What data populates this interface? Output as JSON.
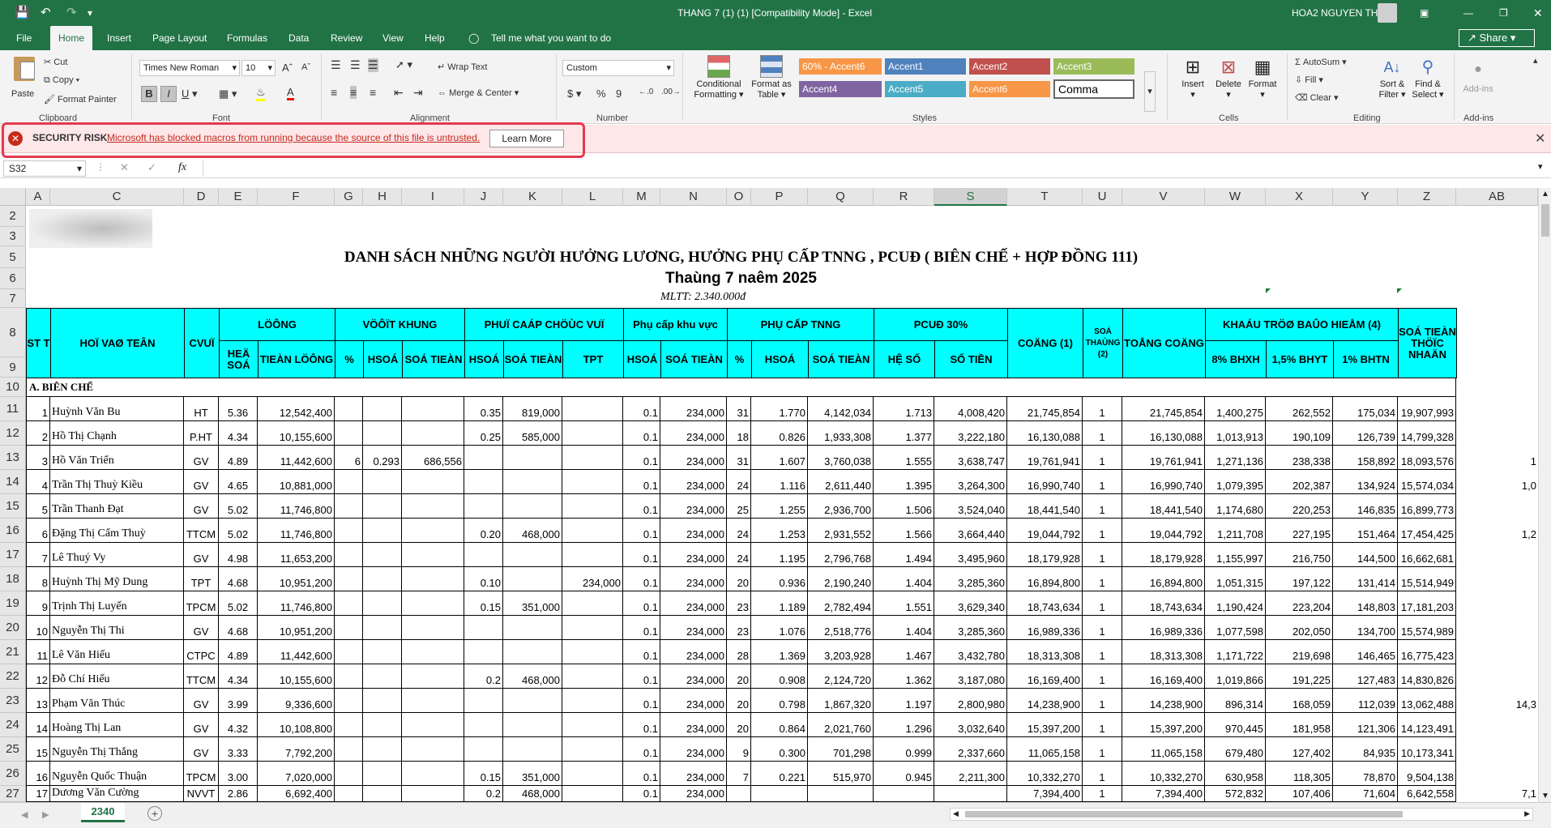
{
  "titlebar": {
    "doc_title": "THANG 7 (1) (1)  [Compatibility Mode]  -  Excel",
    "user": "HOA2 NGUYEN THI"
  },
  "tabs": [
    "File",
    "Home",
    "Insert",
    "Page Layout",
    "Formulas",
    "Data",
    "Review",
    "View",
    "Help"
  ],
  "tell_me": "Tell me what you want to do",
  "share": "Share",
  "ribbon": {
    "paste": "Paste",
    "cut": "Cut",
    "copy": "Copy",
    "format_painter": "Format Painter",
    "clipboard": "Clipboard",
    "font_name": "Times New Roman",
    "font_size": "10",
    "font_group": "Font",
    "bold": "B",
    "italic": "I",
    "underline": "U",
    "wrap_text": "Wrap Text",
    "merge_center": "Merge & Center",
    "alignment": "Alignment",
    "number_format": "Custom",
    "number": "Number",
    "cond_fmt_1": "Conditional",
    "cond_fmt_2": "Formatting",
    "fmt_table_1": "Format as",
    "fmt_table_2": "Table",
    "styles_group": "Styles",
    "styles": [
      {
        "label": "60% - Accent6",
        "color": "#f79646"
      },
      {
        "label": "Accent1",
        "color": "#4f81bd"
      },
      {
        "label": "Accent2",
        "color": "#c0504d"
      },
      {
        "label": "Accent3",
        "color": "#9bbb59"
      },
      {
        "label": "Accent4",
        "color": "#8064a2"
      },
      {
        "label": "Accent5",
        "color": "#4bacc6"
      },
      {
        "label": "Accent6",
        "color": "#f79646"
      },
      {
        "label": "Comma",
        "color": "#ffffff"
      }
    ],
    "insert": "Insert",
    "delete": "Delete",
    "format": "Format",
    "cells": "Cells",
    "autosum": "AutoSum",
    "fill": "Fill",
    "clear": "Clear",
    "sort_1": "Sort &",
    "sort_2": "Filter",
    "find_1": "Find &",
    "find_2": "Select",
    "editing": "Editing",
    "addins": "Add-ins",
    "addins_group": "Add-ins"
  },
  "security": {
    "label": "SECURITY RISK",
    "message": "Microsoft has blocked macros from running because the source of this file is untrusted.",
    "button": "Learn More"
  },
  "formula_bar": {
    "name_box": "S32",
    "fx": "fx",
    "value": ""
  },
  "columns": [
    "A",
    "C",
    "D",
    "E",
    "F",
    "G",
    "H",
    "I",
    "J",
    "K",
    "L",
    "M",
    "N",
    "O",
    "P",
    "Q",
    "R",
    "S",
    "T",
    "U",
    "V",
    "W",
    "X",
    "Y",
    "Z",
    "AB"
  ],
  "row_numbers": [
    "2",
    "3",
    "5",
    "6",
    "7",
    "8",
    "9",
    "10",
    "11",
    "12",
    "13",
    "14",
    "15",
    "16",
    "17",
    "18",
    "19",
    "20",
    "21",
    "22",
    "23",
    "24",
    "25",
    "26",
    "27"
  ],
  "sheet": {
    "title": "DANH SÁCH NHỮNG NGƯỜI HƯỞNG LƯƠNG, HƯỞNG PHỤ CẤP TNNG , PCUĐ ( BIÊN CHẾ + HỢP ĐỒNG 111)",
    "subtitle": "Thaùng 7 naêm 2025",
    "mltt": "MLTT: 2.340.000đ",
    "section_a": "A. BIÊN CHẾ"
  },
  "headers": {
    "stt": "ST T",
    "hoten": "HOÏ VAØ TEÂN",
    "cvu": "CVUÏ",
    "luong": "LÖÔNG",
    "heso": "HEÄ SOÁ",
    "tienluong": "TIEÀN LÖÔNG",
    "vuotkhung": "VÖÔÏT KHUNG",
    "pct": "%",
    "hsoa": "HSOÁ",
    "sotien": "SOÁ TIEÀN",
    "pccv": "PHUÏ CAÁP CHÖÙC VUÏ",
    "tpt": "TPT",
    "kv": "Phụ cấp khu vực",
    "tnng": "PHỤ CẤP TNNG",
    "pcud": "PCUĐ 30%",
    "heso2": "HỆ SỐ",
    "sotien2": "SỐ TIỀN",
    "cong1": "COÄNG (1)",
    "sothang": "SOÁ THAÙNG (2)",
    "tongcong": "TOÅNG COÄNG",
    "khautru": "KHAÁU TRÖØ BAÛO HIEÅM (4)",
    "bhxh": "8% BHXH",
    "bhyt": "1,5% BHYT",
    "bhtn": "1%   BHTN",
    "thucnhan": "SOÁ TIEÀN THÖÏC NHAÄN"
  },
  "rows": [
    [
      "1",
      "Huỳnh Văn Bu",
      "HT",
      "5.36",
      "12,542,400",
      "",
      "",
      "",
      "0.35",
      "819,000",
      "",
      "0.1",
      "234,000",
      "31",
      "1.770",
      "4,142,034",
      "1.713",
      "4,008,420",
      "21,745,854",
      "1",
      "21,745,854",
      "1,400,275",
      "262,552",
      "175,034",
      "19,907,993",
      ""
    ],
    [
      "2",
      "Hồ Thị Chạnh",
      "P.HT",
      "4.34",
      "10,155,600",
      "",
      "",
      "",
      "0.25",
      "585,000",
      "",
      "0.1",
      "234,000",
      "18",
      "0.826",
      "1,933,308",
      "1.377",
      "3,222,180",
      "16,130,088",
      "1",
      "16,130,088",
      "1,013,913",
      "190,109",
      "126,739",
      "14,799,328",
      ""
    ],
    [
      "3",
      "Hồ Văn Triển",
      "GV",
      "4.89",
      "11,442,600",
      "6",
      "0.293",
      "686,556",
      "",
      "",
      "",
      "0.1",
      "234,000",
      "31",
      "1.607",
      "3,760,038",
      "1.555",
      "3,638,747",
      "19,761,941",
      "1",
      "19,761,941",
      "1,271,136",
      "238,338",
      "158,892",
      "18,093,576",
      "1"
    ],
    [
      "4",
      "Trần Thị Thuỳ Kiều",
      "GV",
      "4.65",
      "10,881,000",
      "",
      "",
      "",
      "",
      "",
      "",
      "0.1",
      "234,000",
      "24",
      "1.116",
      "2,611,440",
      "1.395",
      "3,264,300",
      "16,990,740",
      "1",
      "16,990,740",
      "1,079,395",
      "202,387",
      "134,924",
      "15,574,034",
      "1,0"
    ],
    [
      "5",
      "Trần Thanh Đạt",
      "GV",
      "5.02",
      "11,746,800",
      "",
      "",
      "",
      "",
      "",
      "",
      "0.1",
      "234,000",
      "25",
      "1.255",
      "2,936,700",
      "1.506",
      "3,524,040",
      "18,441,540",
      "1",
      "18,441,540",
      "1,174,680",
      "220,253",
      "146,835",
      "16,899,773",
      ""
    ],
    [
      "6",
      "Đặng Thị Cẩm Thuỳ",
      "TTCM",
      "5.02",
      "11,746,800",
      "",
      "",
      "",
      "0.20",
      "468,000",
      "",
      "0.1",
      "234,000",
      "24",
      "1.253",
      "2,931,552",
      "1.566",
      "3,664,440",
      "19,044,792",
      "1",
      "19,044,792",
      "1,211,708",
      "227,195",
      "151,464",
      "17,454,425",
      "1,2"
    ],
    [
      "7",
      "Lê Thuý Vy",
      "GV",
      "4.98",
      "11,653,200",
      "",
      "",
      "",
      "",
      "",
      "",
      "0.1",
      "234,000",
      "24",
      "1.195",
      "2,796,768",
      "1.494",
      "3,495,960",
      "18,179,928",
      "1",
      "18,179,928",
      "1,155,997",
      "216,750",
      "144,500",
      "16,662,681",
      ""
    ],
    [
      "8",
      "Huỳnh Thị Mỹ Dung",
      "TPT",
      "4.68",
      "10,951,200",
      "",
      "",
      "",
      "0.10",
      "",
      "234,000",
      "0.1",
      "234,000",
      "20",
      "0.936",
      "2,190,240",
      "1.404",
      "3,285,360",
      "16,894,800",
      "1",
      "16,894,800",
      "1,051,315",
      "197,122",
      "131,414",
      "15,514,949",
      ""
    ],
    [
      "9",
      "Trịnh Thị Luyến",
      "TPCM",
      "5.02",
      "11,746,800",
      "",
      "",
      "",
      "0.15",
      "351,000",
      "",
      "0.1",
      "234,000",
      "23",
      "1.189",
      "2,782,494",
      "1.551",
      "3,629,340",
      "18,743,634",
      "1",
      "18,743,634",
      "1,190,424",
      "223,204",
      "148,803",
      "17,181,203",
      ""
    ],
    [
      "10",
      "Nguyễn Thị Thi",
      "GV",
      "4.68",
      "10,951,200",
      "",
      "",
      "",
      "",
      "",
      "",
      "0.1",
      "234,000",
      "23",
      "1.076",
      "2,518,776",
      "1.404",
      "3,285,360",
      "16,989,336",
      "1",
      "16,989,336",
      "1,077,598",
      "202,050",
      "134,700",
      "15,574,989",
      ""
    ],
    [
      "11",
      "Lê Văn Hiếu",
      "CTPC",
      "4.89",
      "11,442,600",
      "",
      "",
      "",
      "",
      "",
      "",
      "0.1",
      "234,000",
      "28",
      "1.369",
      "3,203,928",
      "1.467",
      "3,432,780",
      "18,313,308",
      "1",
      "18,313,308",
      "1,171,722",
      "219,698",
      "146,465",
      "16,775,423",
      ""
    ],
    [
      "12",
      "Đỗ Chí Hiếu",
      "TTCM",
      "4.34",
      "10,155,600",
      "",
      "",
      "",
      "0.2",
      "468,000",
      "",
      "0.1",
      "234,000",
      "20",
      "0.908",
      "2,124,720",
      "1.362",
      "3,187,080",
      "16,169,400",
      "1",
      "16,169,400",
      "1,019,866",
      "191,225",
      "127,483",
      "14,830,826",
      ""
    ],
    [
      "13",
      "Phạm Văn Thúc",
      "GV",
      "3.99",
      "9,336,600",
      "",
      "",
      "",
      "",
      "",
      "",
      "0.1",
      "234,000",
      "20",
      "0.798",
      "1,867,320",
      "1.197",
      "2,800,980",
      "14,238,900",
      "1",
      "14,238,900",
      "896,314",
      "168,059",
      "112,039",
      "13,062,488",
      "14,3"
    ],
    [
      "14",
      "Hoàng Thị Lan",
      "GV",
      "4.32",
      "10,108,800",
      "",
      "",
      "",
      "",
      "",
      "",
      "0.1",
      "234,000",
      "20",
      "0.864",
      "2,021,760",
      "1.296",
      "3,032,640",
      "15,397,200",
      "1",
      "15,397,200",
      "970,445",
      "181,958",
      "121,306",
      "14,123,491",
      ""
    ],
    [
      "15",
      "Nguyễn Thị Thắng",
      "GV",
      "3.33",
      "7,792,200",
      "",
      "",
      "",
      "",
      "",
      "",
      "0.1",
      "234,000",
      "9",
      "0.300",
      "701,298",
      "0.999",
      "2,337,660",
      "11,065,158",
      "1",
      "11,065,158",
      "679,480",
      "127,402",
      "84,935",
      "10,173,341",
      ""
    ],
    [
      "16",
      "Nguyễn Quốc Thuận",
      "TPCM",
      "3.00",
      "7,020,000",
      "",
      "",
      "",
      "0.15",
      "351,000",
      "",
      "0.1",
      "234,000",
      "7",
      "0.221",
      "515,970",
      "0.945",
      "2,211,300",
      "10,332,270",
      "1",
      "10,332,270",
      "630,958",
      "118,305",
      "78,870",
      "9,504,138",
      ""
    ],
    [
      "17",
      "Dương Văn Cường",
      "NVVT",
      "2.86",
      "6,692,400",
      "",
      "",
      "",
      "0.2",
      "468,000",
      "",
      "0.1",
      "234,000",
      "",
      "",
      "",
      "",
      "",
      "7,394,400",
      "1",
      "7,394,400",
      "572,832",
      "107,406",
      "71,604",
      "6,642,558",
      "7,1"
    ]
  ],
  "sheet_tab": "2340"
}
